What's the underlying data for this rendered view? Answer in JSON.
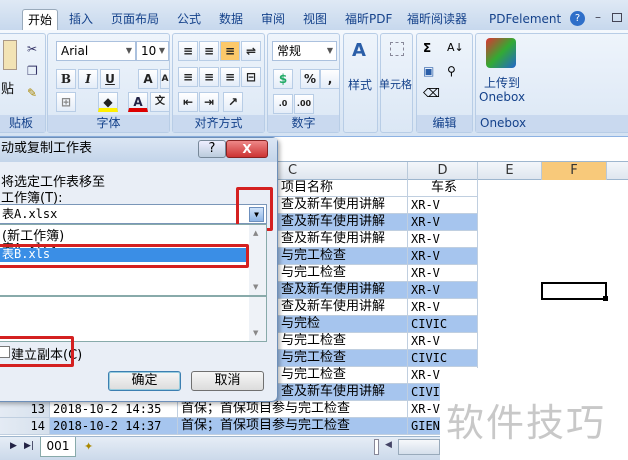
{
  "ribbon": {
    "tabs": [
      "开始",
      "插入",
      "页面布局",
      "公式",
      "数据",
      "审阅",
      "视图",
      "福昕PDF",
      "福昕阅读器",
      "PDFelement"
    ],
    "font_name": "Arial",
    "font_size": "10",
    "number_format": "常规",
    "paste_label": "贴",
    "styles_label": "样式",
    "cells_label": "单元格",
    "onebox_upload": "上传到",
    "onebox_name": "Onebox",
    "groups": [
      "贴板",
      "字体",
      "对齐方式",
      "数字",
      "编辑",
      "Onebox"
    ]
  },
  "columns": [
    "C",
    "D",
    "E",
    "F"
  ],
  "rows": [
    {
      "c": "项目名称",
      "d": "车系",
      "header": true
    },
    {
      "c": "查及新车使用讲解",
      "d": "XR-V"
    },
    {
      "c": "查及新车使用讲解",
      "d": "XR-V"
    },
    {
      "c": "查及新车使用讲解",
      "d": "XR-V"
    },
    {
      "c": "与完工检查",
      "d": "XR-V"
    },
    {
      "c": "与完工检查",
      "d": "XR-V"
    },
    {
      "c": "查及新车使用讲解",
      "d": "XR-V"
    },
    {
      "c": "查及新车使用讲解",
      "d": "XR-V"
    },
    {
      "c": "与完检",
      "d": "CIVIC"
    },
    {
      "c": "与完工检查",
      "d": "XR-V"
    },
    {
      "c": "与完工检查",
      "d": "CIVIC"
    },
    {
      "c": "与完工检查",
      "d": "XR-V"
    },
    {
      "c": "查及新车使用讲解",
      "d": "CIVIC"
    },
    {
      "n": "13",
      "b": "2018-10-2 14:35",
      "c": "首保；首保项目参与完工检查",
      "d": "XR-V"
    },
    {
      "n": "14",
      "b": "2018-10-2 14:37",
      "c": "首保；首保项目参与完工检查",
      "d": "GIENI"
    }
  ],
  "dialog": {
    "title": "动或复制工作表",
    "help": "?",
    "close": "X",
    "move_to_label": "将选定工作表移至",
    "workbook_label": "工作簿(T):",
    "workbook_value": "表A.xlsx",
    "list": [
      "(新工作簿)",
      "表A.xlsx",
      "表B.xls"
    ],
    "copy_label": "建立副本(C)",
    "ok": "确定",
    "cancel": "取消"
  },
  "sheet_tab": "001",
  "watermark": "软件技巧"
}
